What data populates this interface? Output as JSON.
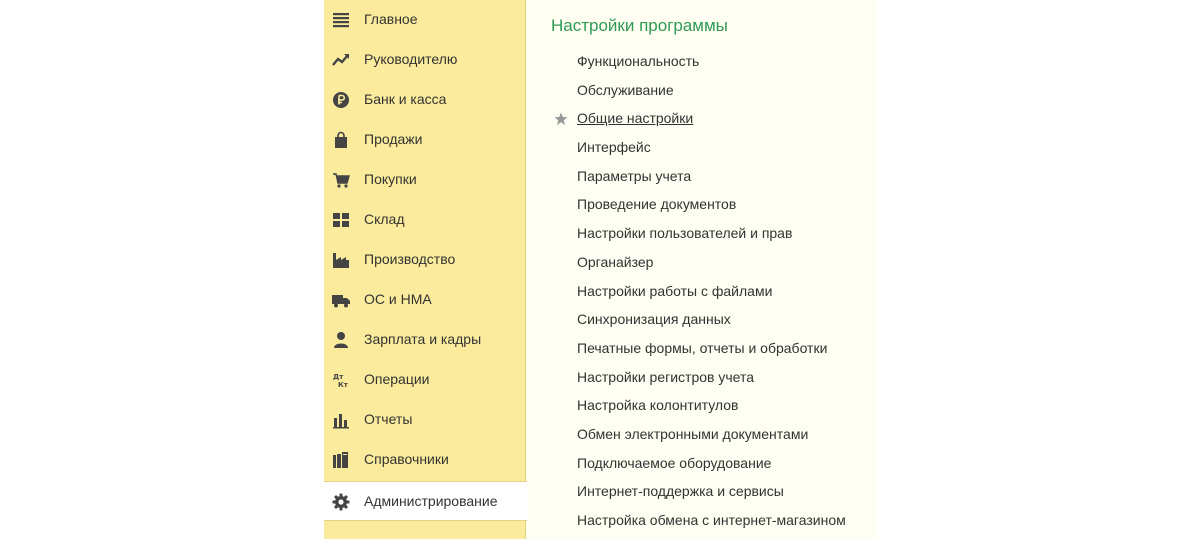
{
  "sidebar": {
    "items": [
      {
        "label": "Главное",
        "icon": "menu-lines-icon"
      },
      {
        "label": "Руководителю",
        "icon": "trend-up-icon"
      },
      {
        "label": "Банк и касса",
        "icon": "ruble-coin-icon"
      },
      {
        "label": "Продажи",
        "icon": "shopping-bag-icon"
      },
      {
        "label": "Покупки",
        "icon": "cart-icon"
      },
      {
        "label": "Склад",
        "icon": "warehouse-grid-icon"
      },
      {
        "label": "Производство",
        "icon": "factory-icon"
      },
      {
        "label": "ОС и НМА",
        "icon": "truck-icon"
      },
      {
        "label": "Зарплата и кадры",
        "icon": "person-icon"
      },
      {
        "label": "Операции",
        "icon": "debit-credit-icon"
      },
      {
        "label": "Отчеты",
        "icon": "bar-chart-icon"
      },
      {
        "label": "Справочники",
        "icon": "books-icon"
      },
      {
        "label": "Администрирование",
        "icon": "gear-icon",
        "active": true
      }
    ]
  },
  "content": {
    "title": "Настройки программы",
    "items": [
      {
        "label": "Функциональность"
      },
      {
        "label": "Обслуживание"
      },
      {
        "label": "Общие настройки",
        "starred": true,
        "underlined": true
      },
      {
        "label": "Интерфейс"
      },
      {
        "label": "Параметры учета"
      },
      {
        "label": "Проведение документов"
      },
      {
        "label": "Настройки пользователей и прав"
      },
      {
        "label": "Органайзер"
      },
      {
        "label": "Настройки работы с файлами"
      },
      {
        "label": "Синхронизация данных"
      },
      {
        "label": "Печатные формы, отчеты и обработки"
      },
      {
        "label": "Настройки регистров учета"
      },
      {
        "label": "Настройка колонтитулов"
      },
      {
        "label": "Обмен электронными документами"
      },
      {
        "label": "Подключаемое оборудование"
      },
      {
        "label": "Интернет-поддержка и сервисы"
      },
      {
        "label": "Настройка обмена с интернет-магазином"
      }
    ]
  },
  "colors": {
    "sidebar_bg": "#fbec9d",
    "content_bg": "#fefef2",
    "title_green": "#2f9b55",
    "text": "#333333",
    "icon": "#444444",
    "star": "#9a9a9a"
  }
}
